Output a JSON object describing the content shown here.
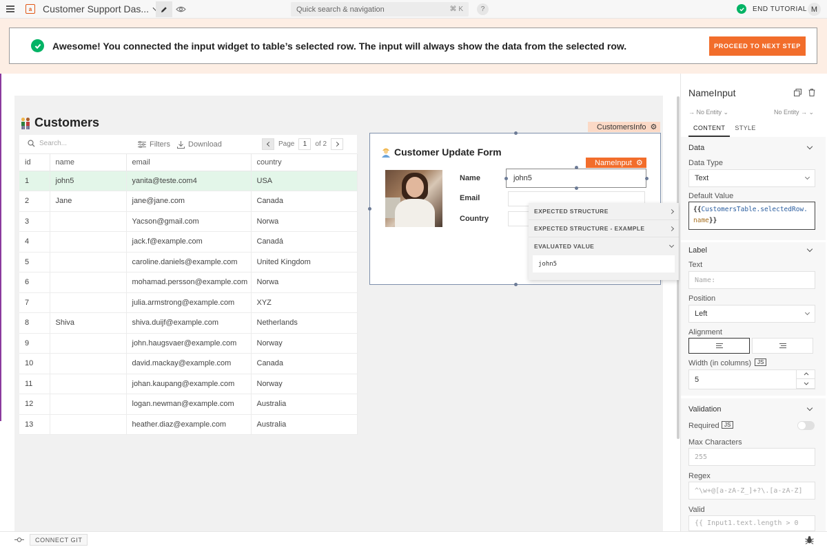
{
  "topbar": {
    "app_title": "Customer Support Das...",
    "logo_glyph": "a",
    "search_label": "Quick search & navigation",
    "search_shortcut": "⌘ K",
    "help_label": "?",
    "end_tutorial_label": "END TUTORIAL",
    "avatar_initial": "M"
  },
  "banner": {
    "message": "Awesome! You connected the input widget to table’s selected row. The input will always show the data from the selected row.",
    "proceed_label": "PROCEED TO NEXT STEP"
  },
  "customers": {
    "title": "Customers",
    "search_placeholder": "Search...",
    "filters_label": "Filters",
    "download_label": "Download",
    "page_label": "Page",
    "page_value": "1",
    "page_of": "of 2",
    "columns": [
      "id",
      "name",
      "email",
      "country"
    ],
    "selected_row_index": 0,
    "rows": [
      [
        "1",
        "john5",
        "yanita@teste.com4",
        "USA"
      ],
      [
        "2",
        "Jane",
        "jane@jane.com",
        "Canada"
      ],
      [
        "3",
        "",
        "Yacson@gmail.com",
        "Norwa"
      ],
      [
        "4",
        "",
        "jack.f@example.com",
        "Canadá"
      ],
      [
        "5",
        "",
        "caroline.daniels@example.com",
        "United Kingdom"
      ],
      [
        "6",
        "",
        "mohamad.persson@example.com",
        "Norwa"
      ],
      [
        "7",
        "",
        "julia.armstrong@example.com",
        "XYZ"
      ],
      [
        "8",
        "Shiva",
        "shiva.duijf@example.com",
        "Netherlands"
      ],
      [
        "9",
        "",
        "john.haugsvaer@example.com",
        "Norway"
      ],
      [
        "10",
        "",
        "david.mackay@example.com",
        "Canada"
      ],
      [
        "11",
        "",
        "johan.kaupang@example.com",
        "Norway"
      ],
      [
        "12",
        "",
        "logan.newman@example.com",
        "Australia"
      ],
      [
        "13",
        "",
        "heather.diaz@example.com",
        "Australia"
      ]
    ]
  },
  "form": {
    "container_tag": "CustomersInfo",
    "title": "Customer Update Form",
    "input_tag": "NameInput",
    "name_label": "Name",
    "name_value": "john5",
    "email_label": "Email",
    "country_label": "Country"
  },
  "evaluation": {
    "expected_structure": "EXPECTED STRUCTURE",
    "expected_example": "EXPECTED STRUCTURE - EXAMPLE",
    "evaluated_value_label": "EVALUATED VALUE",
    "evaluated_value": "john5"
  },
  "panel": {
    "widget_name": "NameInput",
    "entity_left": "→ No Entity ⌄",
    "entity_right": "No Entity → ⌄",
    "tabs": [
      "CONTENT",
      "STYLE"
    ],
    "data_section": "Data",
    "data_type_label": "Data Type",
    "data_type_value": "Text",
    "default_value_label": "Default Value",
    "default_value_open": "{{",
    "default_value_ident": "CustomersTable.selectedRo",
    "default_value_ident2": "w.",
    "default_value_prop": "name",
    "default_value_close": "}}",
    "label_section": "Label",
    "text_label": "Text",
    "text_placeholder": "Name:",
    "position_label": "Position",
    "position_value": "Left",
    "alignment_label": "Alignment",
    "width_label": "Width (in columns)",
    "js_badge": "JS",
    "width_value": "5",
    "validation_section": "Validation",
    "required_label": "Required",
    "max_chars_label": "Max Characters",
    "max_chars_placeholder": "255",
    "regex_label": "Regex",
    "regex_placeholder": "^\\w+@[a-zA-Z_]+?\\.[a-zA-Z]",
    "valid_label": "Valid",
    "valid_placeholder": "{{ Input1.text.length > 0"
  },
  "bottombar": {
    "connect_git_label": "CONNECT GIT"
  },
  "colors": {
    "accent": "#f26d2b",
    "success": "#03b365",
    "selected_row": "#e3f6e9",
    "banner_bg": "#fdeee4"
  }
}
